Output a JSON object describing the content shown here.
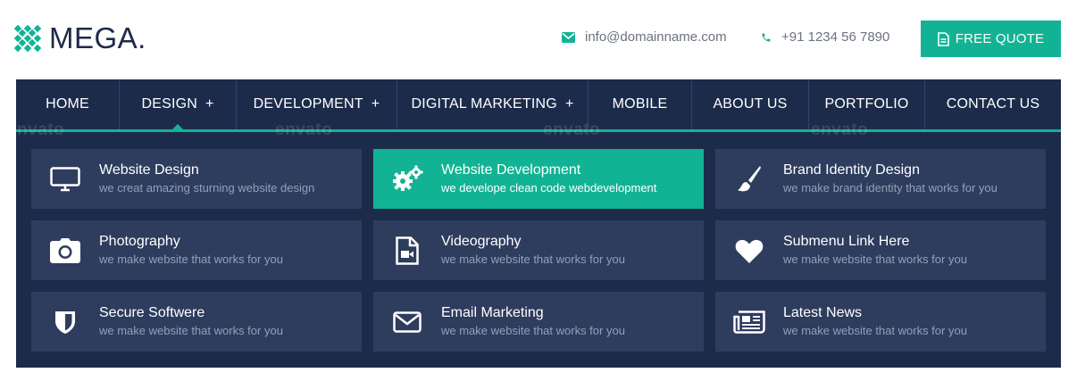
{
  "header": {
    "logo_text": "MEGA.",
    "email": "info@domainname.com",
    "phone": "+91 1234 56 7890",
    "quote_label": "FREE QUOTE"
  },
  "nav": {
    "items": [
      {
        "label": "HOME",
        "plus": ""
      },
      {
        "label": "DESIGN",
        "plus": "+"
      },
      {
        "label": "DEVELOPMENT",
        "plus": "+"
      },
      {
        "label": "DIGITAL MARKETING",
        "plus": "+"
      },
      {
        "label": "MOBILE",
        "plus": ""
      },
      {
        "label": "ABOUT US",
        "plus": ""
      },
      {
        "label": "PORTFOLIO",
        "plus": ""
      },
      {
        "label": "CONTACT US",
        "plus": ""
      }
    ],
    "active_item": "DESIGN"
  },
  "mega_menu": {
    "items": [
      {
        "title": "Website Design",
        "desc": "we creat amazing sturning website design",
        "icon": "monitor-icon"
      },
      {
        "title": "Website Development",
        "desc": "we develope clean code webdevelopment",
        "icon": "gears-icon"
      },
      {
        "title": "Brand Identity Design",
        "desc": "we make brand identity that works for you",
        "icon": "paint-brush-icon"
      },
      {
        "title": "Photography",
        "desc": "we make website that works for you",
        "icon": "camera-icon"
      },
      {
        "title": "Videography",
        "desc": "we make website that works for you",
        "icon": "video-file-icon"
      },
      {
        "title": "Submenu Link Here",
        "desc": "we make website that works for you",
        "icon": "heart-icon"
      },
      {
        "title": "Secure Softwere",
        "desc": "we make website that works for you",
        "icon": "shield-icon"
      },
      {
        "title": "Email Marketing",
        "desc": "we make website that works for you",
        "icon": "envelope-icon"
      },
      {
        "title": "Latest News",
        "desc": "we make website that works for you",
        "icon": "newspaper-icon"
      }
    ],
    "active_item": "Website Development"
  },
  "watermark": "envato",
  "colors": {
    "accent": "#12b394",
    "navy": "#1d2b4b",
    "card": "#2e3c5e",
    "logo_text": "#1e2a4a"
  }
}
